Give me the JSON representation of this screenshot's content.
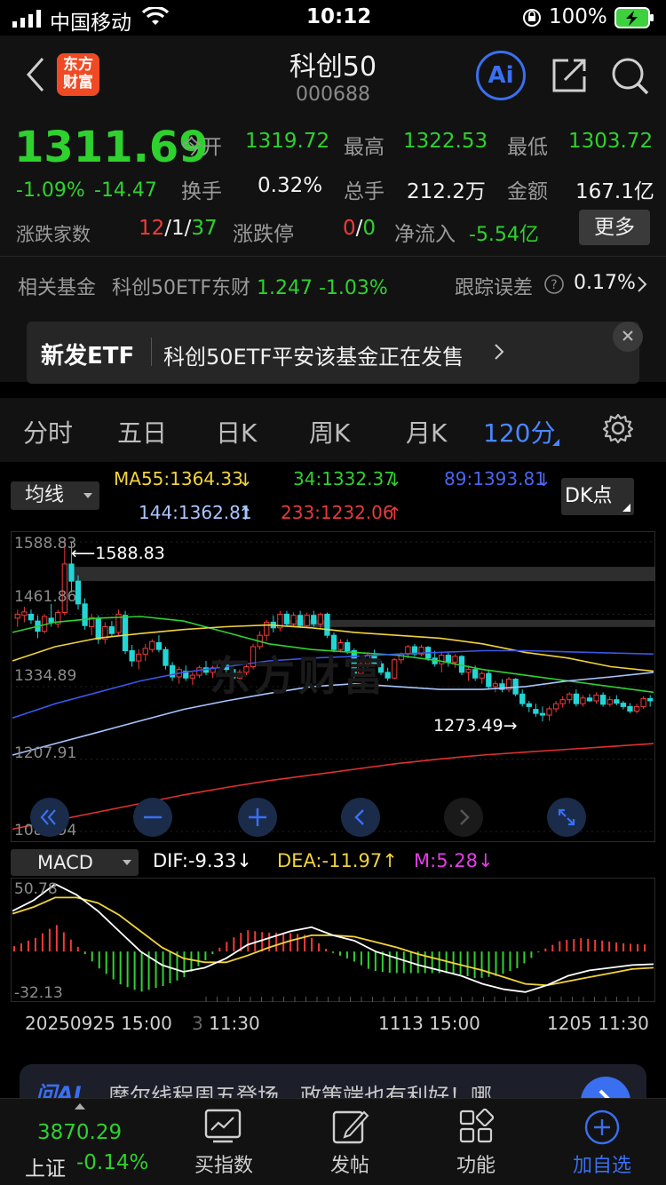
{
  "status_bar": {
    "carrier": "中国移动",
    "time": "10:12",
    "battery": "100%"
  },
  "header": {
    "logo_line1": "东方",
    "logo_line2": "财富",
    "title": "科创50",
    "code": "000688",
    "ai_label": "Ai"
  },
  "quote": {
    "price": "1311.69",
    "change_pct": "-1.09%",
    "change": "-14.47",
    "open_label": "今开",
    "open": "1319.72",
    "high_label": "最高",
    "high": "1322.53",
    "low_label": "最低",
    "low": "1303.72",
    "turnover_label": "换手",
    "turnover": "0.32%",
    "volume_label": "总手",
    "volume": "212.2万",
    "amount_label": "金额",
    "amount": "167.1亿",
    "breadth_label": "涨跌家数",
    "breadth_up": "12",
    "breadth_sep1": "/",
    "breadth_flat": "1",
    "breadth_sep2": "/",
    "breadth_down": "37",
    "limit_label": "涨跌停",
    "limit_up": "0",
    "limit_sep": "/",
    "limit_down": "0",
    "netflow_label": "净流入",
    "netflow": "-5.54亿",
    "more_button": "更多"
  },
  "fund": {
    "label": "相关基金",
    "name": "科创50ETF东财",
    "price": "1.247",
    "change_pct": "-1.03%",
    "tracking_label": "跟踪误差",
    "tracking_value": "0.17%"
  },
  "banner": {
    "tag": "新发ETF",
    "text": "科创50ETF平安该基金正在发售"
  },
  "tabs": [
    {
      "label": "分时",
      "active": false
    },
    {
      "label": "五日",
      "active": false
    },
    {
      "label": "日K",
      "active": false
    },
    {
      "label": "周K",
      "active": false
    },
    {
      "label": "月K",
      "active": false
    },
    {
      "label": "120分",
      "active": true
    }
  ],
  "ma_legend": {
    "selector": "均线",
    "ma55": "MA55:1364.33",
    "ma34": "34:1332.37",
    "ma89": "89:1393.81",
    "ma144": "144:1362.81",
    "ma233": "233:1232.06",
    "dk_button": "DK点",
    "colors": {
      "ma55": "#f2d33a",
      "ma34": "#2fd12f",
      "ma89": "#3b57e6",
      "ma144": "#a9c6ff",
      "ma233": "#e03030"
    }
  },
  "price_axis": {
    "t1": "1588.83",
    "t2": "1461.86",
    "t3": "1334.89",
    "t4": "1207.91",
    "t5": "1080.94"
  },
  "annotations": {
    "high": "1588.83",
    "low": "1273.49"
  },
  "watermark": "东方财富",
  "macd": {
    "selector": "MACD",
    "dif": "DIF:-9.33",
    "dea": "DEA:-11.97",
    "m": "M:5.28",
    "axis_top": "50.78",
    "axis_bottom": "-32.13"
  },
  "time_axis": {
    "t1": "20250925 15:00",
    "t2": "11:30",
    "t3": "1113 15:00",
    "t4": "1205 11:30"
  },
  "ai_bar": {
    "brand": "问AI",
    "text": "摩尔线程周五登场，政策端也有利好！哪"
  },
  "bottom_nav": {
    "index_value": "3870.29",
    "index_name": "上证",
    "index_change": "-0.14%",
    "items": [
      "买指数",
      "发帖",
      "功能",
      "加自选"
    ]
  },
  "chart_data": {
    "type": "candlestick",
    "title": "",
    "ylim": [
      1080.94,
      1588.83
    ],
    "yticks": [
      1588.83,
      1461.86,
      1334.89,
      1207.91,
      1080.94
    ],
    "xlabels": [
      "20250925 15:00",
      "11:30",
      "1113 15:00",
      "1205 11:30"
    ],
    "high_mark": 1588.83,
    "low_mark": 1273.49,
    "candles": [
      [
        1455,
        1470,
        1440,
        1462
      ],
      [
        1460,
        1475,
        1448,
        1466
      ],
      [
        1462,
        1470,
        1445,
        1452
      ],
      [
        1450,
        1460,
        1420,
        1432
      ],
      [
        1432,
        1462,
        1428,
        1458
      ],
      [
        1455,
        1480,
        1440,
        1448
      ],
      [
        1445,
        1470,
        1438,
        1465
      ],
      [
        1465,
        1590,
        1460,
        1550
      ],
      [
        1550,
        1588,
        1500,
        1520
      ],
      [
        1520,
        1530,
        1470,
        1480
      ],
      [
        1480,
        1490,
        1435,
        1442
      ],
      [
        1440,
        1462,
        1425,
        1456
      ],
      [
        1455,
        1460,
        1410,
        1418
      ],
      [
        1418,
        1448,
        1410,
        1440
      ],
      [
        1440,
        1450,
        1422,
        1428
      ],
      [
        1430,
        1470,
        1425,
        1462
      ],
      [
        1460,
        1468,
        1392,
        1398
      ],
      [
        1398,
        1408,
        1370,
        1380
      ],
      [
        1380,
        1400,
        1365,
        1392
      ],
      [
        1392,
        1410,
        1380,
        1402
      ],
      [
        1400,
        1418,
        1395,
        1414
      ],
      [
        1412,
        1425,
        1395,
        1400
      ],
      [
        1400,
        1405,
        1365,
        1372
      ],
      [
        1372,
        1378,
        1345,
        1352
      ],
      [
        1352,
        1370,
        1340,
        1365
      ],
      [
        1362,
        1372,
        1345,
        1350
      ],
      [
        1350,
        1360,
        1338,
        1355
      ],
      [
        1355,
        1372,
        1350,
        1368
      ],
      [
        1368,
        1380,
        1355,
        1360
      ],
      [
        1360,
        1372,
        1350,
        1368
      ],
      [
        1368,
        1382,
        1362,
        1378
      ],
      [
        1378,
        1385,
        1360,
        1365
      ],
      [
        1365,
        1370,
        1345,
        1350
      ],
      [
        1350,
        1365,
        1342,
        1360
      ],
      [
        1360,
        1375,
        1355,
        1370
      ],
      [
        1370,
        1410,
        1365,
        1405
      ],
      [
        1405,
        1432,
        1400,
        1425
      ],
      [
        1425,
        1452,
        1415,
        1448
      ],
      [
        1448,
        1460,
        1430,
        1438
      ],
      [
        1438,
        1468,
        1432,
        1462
      ],
      [
        1462,
        1468,
        1440,
        1445
      ],
      [
        1445,
        1465,
        1440,
        1460
      ],
      [
        1460,
        1468,
        1438,
        1442
      ],
      [
        1442,
        1465,
        1438,
        1460
      ],
      [
        1460,
        1468,
        1440,
        1445
      ],
      [
        1445,
        1465,
        1438,
        1462
      ],
      [
        1462,
        1465,
        1420,
        1425
      ],
      [
        1425,
        1430,
        1395,
        1400
      ],
      [
        1400,
        1418,
        1395,
        1412
      ],
      [
        1412,
        1418,
        1392,
        1398
      ],
      [
        1398,
        1402,
        1350,
        1358
      ],
      [
        1358,
        1380,
        1355,
        1375
      ],
      [
        1375,
        1395,
        1368,
        1390
      ],
      [
        1390,
        1400,
        1370,
        1375
      ],
      [
        1375,
        1380,
        1355,
        1360
      ],
      [
        1360,
        1368,
        1345,
        1350
      ],
      [
        1350,
        1385,
        1348,
        1382
      ],
      [
        1382,
        1395,
        1375,
        1392
      ],
      [
        1392,
        1408,
        1385,
        1405
      ],
      [
        1405,
        1410,
        1388,
        1392
      ],
      [
        1392,
        1408,
        1388,
        1404
      ],
      [
        1404,
        1406,
        1380,
        1385
      ],
      [
        1385,
        1398,
        1370,
        1375
      ],
      [
        1375,
        1395,
        1360,
        1390
      ],
      [
        1390,
        1395,
        1370,
        1378
      ],
      [
        1378,
        1392,
        1368,
        1388
      ],
      [
        1388,
        1390,
        1355,
        1360
      ],
      [
        1360,
        1372,
        1345,
        1365
      ],
      [
        1365,
        1372,
        1345,
        1350
      ],
      [
        1350,
        1362,
        1340,
        1358
      ],
      [
        1358,
        1365,
        1330,
        1335
      ],
      [
        1335,
        1345,
        1325,
        1340
      ],
      [
        1340,
        1348,
        1325,
        1330
      ],
      [
        1330,
        1352,
        1325,
        1348
      ],
      [
        1348,
        1350,
        1318,
        1322
      ],
      [
        1322,
        1330,
        1300,
        1305
      ],
      [
        1305,
        1310,
        1290,
        1300
      ],
      [
        1295,
        1305,
        1282,
        1288
      ],
      [
        1288,
        1300,
        1274,
        1285
      ],
      [
        1285,
        1300,
        1275,
        1296
      ],
      [
        1296,
        1310,
        1290,
        1305
      ],
      [
        1305,
        1318,
        1298,
        1312
      ],
      [
        1312,
        1325,
        1305,
        1322
      ],
      [
        1322,
        1330,
        1300,
        1305
      ],
      [
        1305,
        1320,
        1300,
        1315
      ],
      [
        1315,
        1322,
        1308,
        1310
      ],
      [
        1310,
        1325,
        1305,
        1320
      ],
      [
        1320,
        1325,
        1300,
        1304
      ],
      [
        1304,
        1318,
        1300,
        1312
      ],
      [
        1312,
        1320,
        1302,
        1306
      ],
      [
        1306,
        1310,
        1295,
        1300
      ],
      [
        1300,
        1306,
        1288,
        1292
      ],
      [
        1292,
        1305,
        1288,
        1300
      ],
      [
        1300,
        1318,
        1296,
        1314
      ],
      [
        1314,
        1320,
        1300,
        1310
      ]
    ],
    "ma_lines": {
      "MA34": [
        1430,
        1448,
        1455,
        1458,
        1450,
        1430,
        1410,
        1400,
        1395,
        1390,
        1380,
        1365,
        1355,
        1345,
        1335,
        1325
      ],
      "MA55": [
        1380,
        1405,
        1420,
        1428,
        1435,
        1440,
        1443,
        1438,
        1430,
        1425,
        1420,
        1410,
        1395,
        1385,
        1370,
        1362
      ],
      "MA89": [
        1280,
        1305,
        1325,
        1345,
        1360,
        1370,
        1380,
        1385,
        1388,
        1392,
        1395,
        1398,
        1398,
        1396,
        1394,
        1392
      ],
      "MA144": [
        1215,
        1235,
        1255,
        1275,
        1295,
        1310,
        1323,
        1335,
        1340,
        1335,
        1330,
        1330,
        1335,
        1345,
        1352,
        1360
      ],
      "MA233": [
        1085,
        1100,
        1115,
        1130,
        1145,
        1158,
        1170,
        1180,
        1190,
        1200,
        1208,
        1215,
        1220,
        1225,
        1230,
        1235
      ]
    },
    "macd": {
      "ylim": [
        -32.13,
        50.78
      ],
      "dif": [
        30,
        38,
        50,
        42,
        30,
        15,
        0,
        -10,
        -15,
        -12,
        -5,
        5,
        10,
        15,
        18,
        12,
        8,
        0,
        -5,
        -10,
        -14,
        -18,
        -24,
        -28,
        -30,
        -25,
        -18,
        -14,
        -12,
        -10,
        -9.33
      ],
      "dea": [
        28,
        33,
        40,
        40,
        36,
        27,
        15,
        3,
        -5,
        -8,
        -8,
        -3,
        3,
        8,
        12,
        12,
        11,
        7,
        3,
        -2,
        -6,
        -10,
        -14,
        -19,
        -24,
        -25,
        -22,
        -19,
        -16,
        -13,
        -11.97
      ],
      "m": [
        4,
        10,
        20,
        4,
        -12,
        -24,
        -30,
        -26,
        -20,
        -8,
        6,
        16,
        14,
        14,
        12,
        0,
        -6,
        -14,
        -16,
        -16,
        -16,
        -16,
        -20,
        -18,
        -12,
        0,
        8,
        10,
        8,
        6,
        5.28
      ]
    }
  }
}
